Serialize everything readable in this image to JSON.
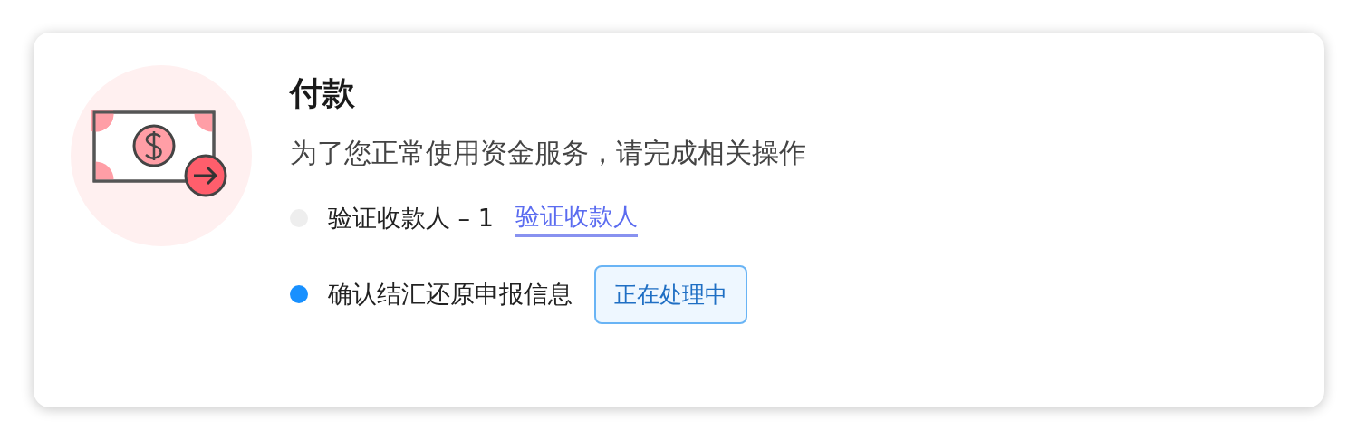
{
  "card": {
    "title": "付款",
    "subtitle": "为了您正常使用资金服务，请完成相关操作",
    "steps": [
      {
        "label": "验证收款人 – 1",
        "color": "#eeeeee",
        "kind": "link",
        "action": "验证收款人"
      },
      {
        "label": "确认结汇还原申报信息",
        "color": "#1890ff",
        "kind": "badge",
        "action": "正在处理中"
      }
    ]
  }
}
